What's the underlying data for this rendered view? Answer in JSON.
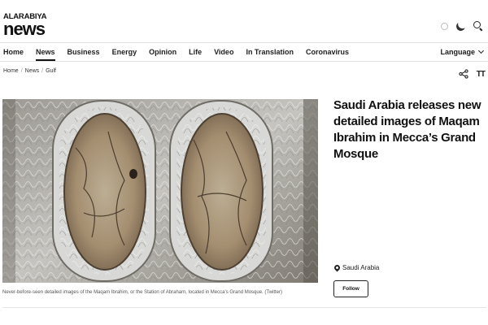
{
  "brand": {
    "top": "ALARABIYA",
    "main": "news"
  },
  "header": {
    "icons": [
      "sun-icon",
      "moon-icon",
      "search-icon"
    ]
  },
  "nav": {
    "items": [
      {
        "label": "Home"
      },
      {
        "label": "News"
      },
      {
        "label": "Business"
      },
      {
        "label": "Energy"
      },
      {
        "label": "Opinion"
      },
      {
        "label": "Life"
      },
      {
        "label": "Video"
      },
      {
        "label": "In Translation"
      },
      {
        "label": "Coronavirus"
      }
    ],
    "active": "News",
    "language_label": "Language"
  },
  "breadcrumb": [
    "Home",
    "News",
    "Gulf"
  ],
  "tools": {
    "share_icon": "share-icon",
    "text_size_label": "TT"
  },
  "article": {
    "headline": "Saudi Arabia releases new detailed images of Maqam Ibrahim in Mecca’s Grand Mosque",
    "caption": "Never-before-seen detailed images of the Maqam Ibrahim, or the Station of Abraham, located in Mecca’s Grand Mosque. (Twitter)",
    "location": "Saudi Arabia",
    "follow_label": "Follow"
  },
  "colors": {
    "text": "#1a1a1a",
    "rule": "#e4e4e4",
    "accent": "#111111"
  }
}
